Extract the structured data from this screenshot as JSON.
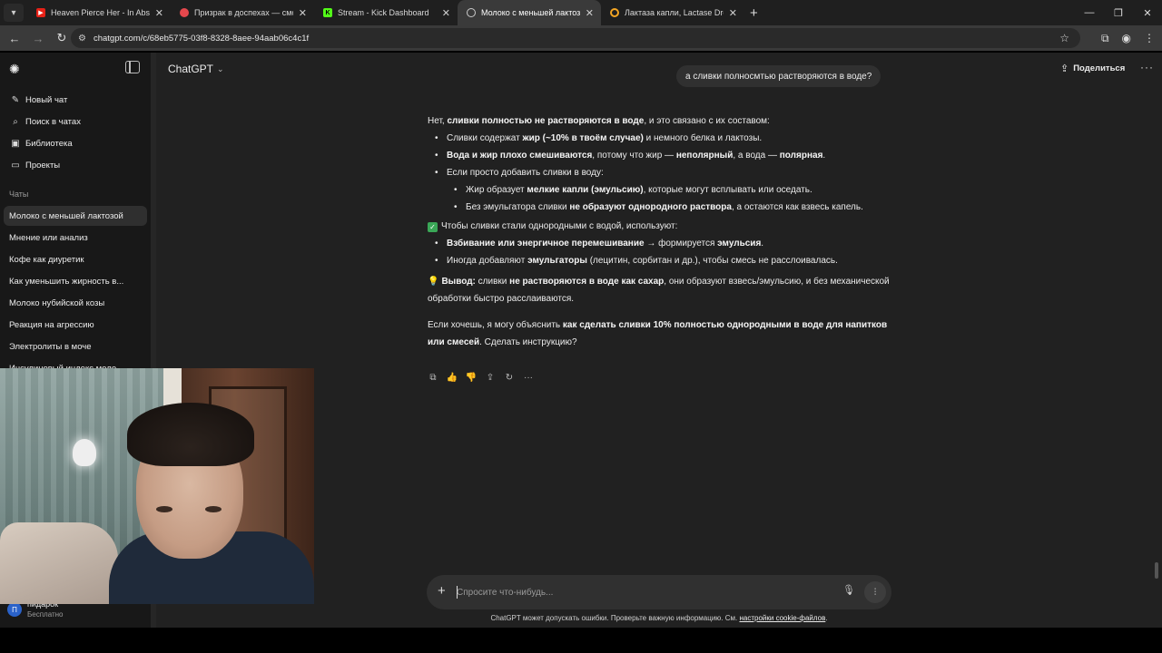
{
  "browser": {
    "tabs": [
      {
        "title": "Heaven Pierce Her - In Absentia",
        "favicon_color": "#e62117",
        "active": false
      },
      {
        "title": "Призрак в доспехах — смотреть",
        "favicon_color": "#e5484d",
        "active": false
      },
      {
        "title": "Stream - Kick Dashboard",
        "favicon_color": "#53fc18",
        "active": false
      },
      {
        "title": "Молоко с меньшей лактозой",
        "favicon_color": "#cccccc",
        "active": true
      },
      {
        "title": "Лактаза капли, Lactase Drops,",
        "favicon_color": "#f5a623",
        "active": false
      }
    ],
    "url": "chatgpt.com/c/68eb5775-03f8-8328-8aee-94aab06c4c1f"
  },
  "sidebar": {
    "nav": [
      {
        "label": "Новый чат",
        "icon": "edit-icon"
      },
      {
        "label": "Поиск в чатах",
        "icon": "search-icon"
      },
      {
        "label": "Библиотека",
        "icon": "library-icon"
      },
      {
        "label": "Проекты",
        "icon": "folder-icon"
      }
    ],
    "section_title": "Чаты",
    "chats": [
      "Молоко с меньшей лактозой",
      "Мнение или анализ",
      "Кофе как диуретик",
      "Как уменьшить жирность в...",
      "Молоко нубийской козы",
      "Реакция на агрессию",
      "Электролиты в моче",
      "Инсулиновый индекс моло"
    ],
    "user": {
      "initial": "П",
      "name": "пидарок",
      "plan": "Бесплатно"
    }
  },
  "main": {
    "model": "ChatGPT",
    "share_label": "Поделиться",
    "user_message": "а сливки полноcмтью растворяются в воде?",
    "answer": {
      "intro": [
        "Нет, ",
        "сливки полностью не растворяются в воде",
        ", и это связано с их составом:"
      ],
      "bullets1": [
        [
          "Сливки содержат ",
          "жир (~10% в твоём случае)",
          " и немного белка и лактозы."
        ],
        [
          "",
          "Вода и жир плохо смешиваются",
          ", потому что жир — ",
          "неполярный",
          ", а вода — ",
          "полярная",
          "."
        ],
        [
          "Если просто добавить сливки в воду:"
        ]
      ],
      "sub_bullets": [
        [
          "Жир образует ",
          "мелкие капли (эмульсию)",
          ", которые могут всплывать или оседать."
        ],
        [
          "Без эмульгатора сливки ",
          "не образуют однородного раствора",
          ", а остаются как взвесь капель."
        ]
      ],
      "check_line": "Чтобы сливки стали однородными с водой, используют:",
      "bullets2": [
        [
          "",
          "Взбивание или энергичное перемешивание",
          " → формируется ",
          "эмульсия",
          "."
        ],
        [
          "Иногда добавляют ",
          "эмульгаторы",
          " (лецитин, сорбитан и др.), чтобы смесь не расслоивалась."
        ]
      ],
      "conclusion": [
        "Вывод:",
        " сливки ",
        "не растворяются в воде как сахар",
        ", они образуют взвесь/эмульсию, и без механической обработки быстро расслаиваются."
      ],
      "offer": [
        "Если хочешь, я могу объяснить ",
        "как сделать сливки 10% полностью однородными в воде для напитков или смесей",
        ". Сделать инструкцию?"
      ]
    },
    "composer_placeholder": "Спросите что-нибудь...",
    "disclaimer": "ChatGPT может допускать ошибки. Проверьте важную информацию. См.",
    "disclaimer_link": "настройки cookie-файлов",
    "disclaimer_end": "."
  }
}
